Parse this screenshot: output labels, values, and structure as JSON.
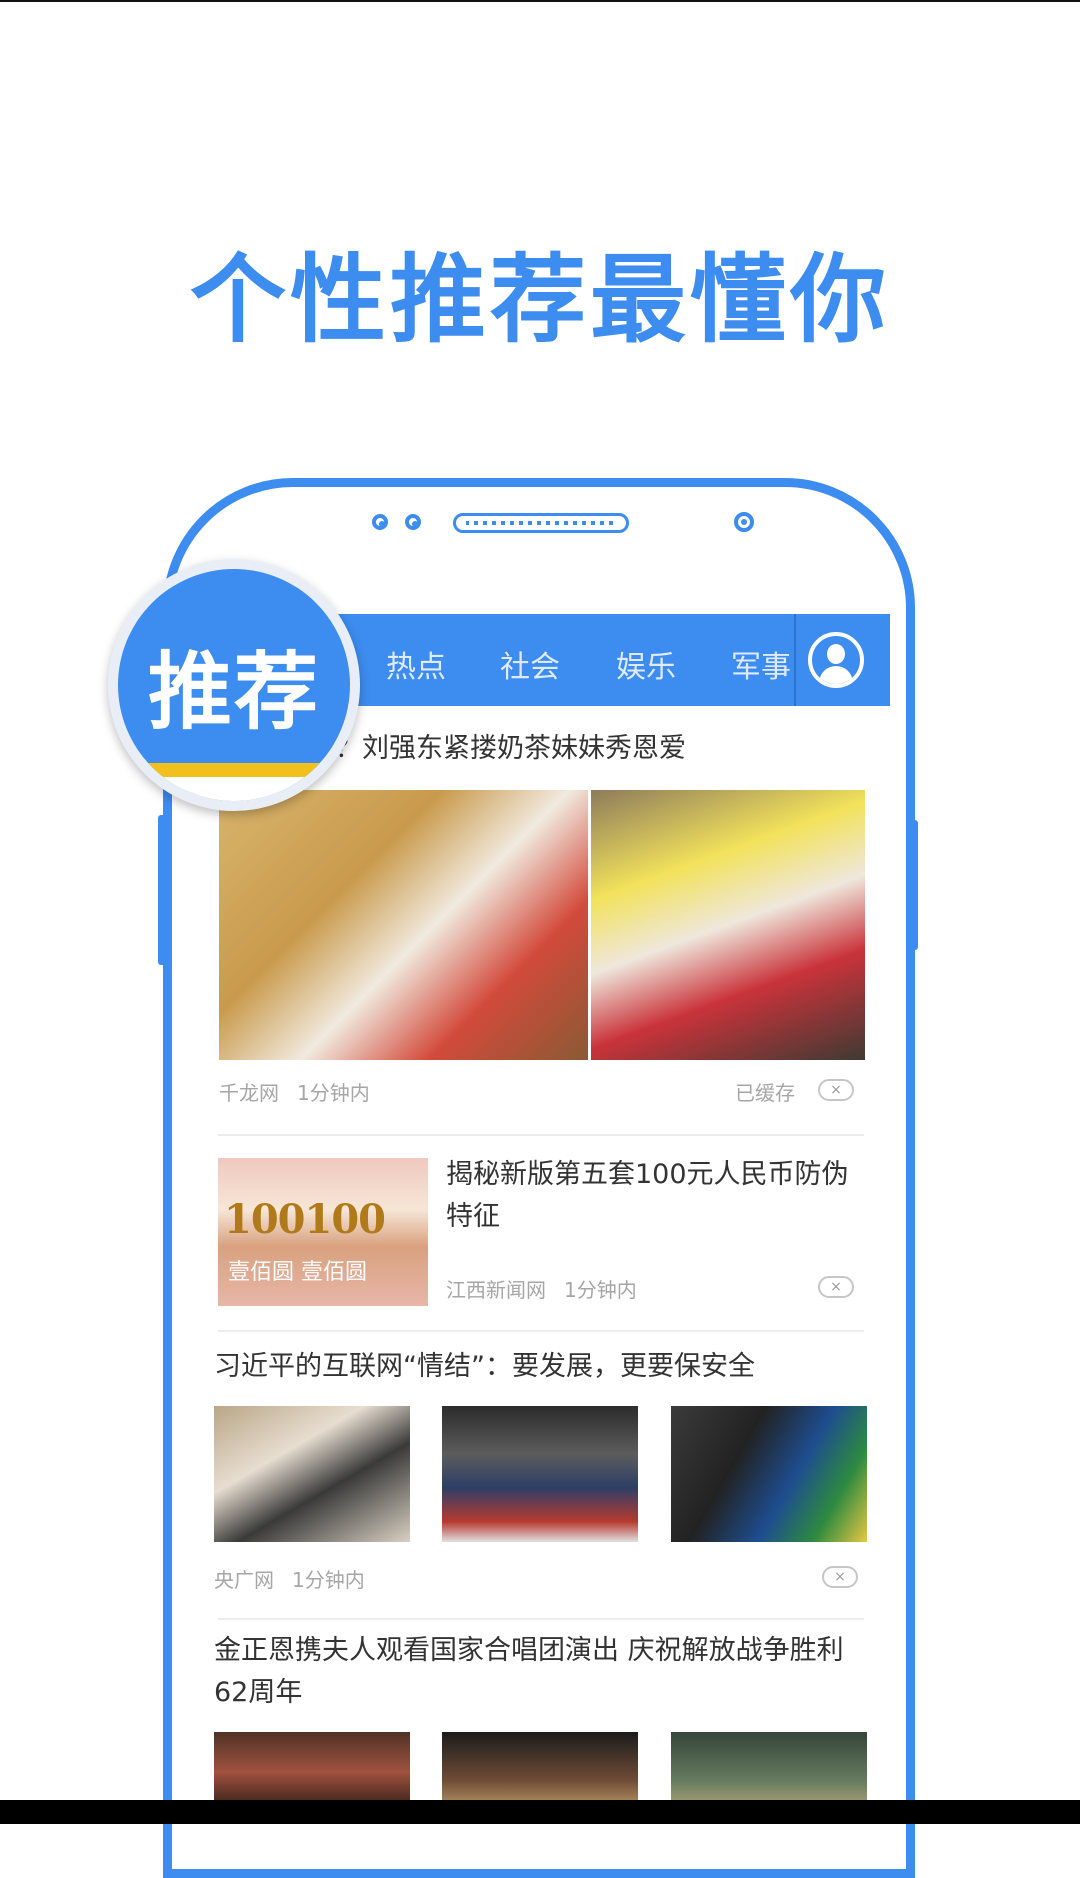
{
  "headline": "个性推荐最懂你",
  "badge_label": "推荐",
  "tabs": [
    "热点",
    "社会",
    "娱乐",
    "军事"
  ],
  "colors": {
    "accent": "#3d8cf0",
    "badge_stripe": "#f2c01c"
  },
  "profile_icon": "user-avatar-icon",
  "articles": [
    {
      "title": "人？刘强东紧搂奶茶妹妹秀恩爱",
      "source": "千龙网",
      "time": "1分钟内",
      "status": "已缓存",
      "close": "×"
    },
    {
      "title": "揭秘新版第五套100元人民币防伪特征",
      "thumb_text": "100100",
      "thumb_marks": "壹佰圆 壹佰圆",
      "source": "江西新闻网",
      "time": "1分钟内",
      "close": "×"
    },
    {
      "title": "习近平的互联网“情结”：要发展，更要保安全",
      "source": "央广网",
      "time": "1分钟内",
      "close": "×"
    },
    {
      "title": "金正恩携夫人观看国家合唱团演出 庆祝解放战争胜利62周年"
    }
  ]
}
